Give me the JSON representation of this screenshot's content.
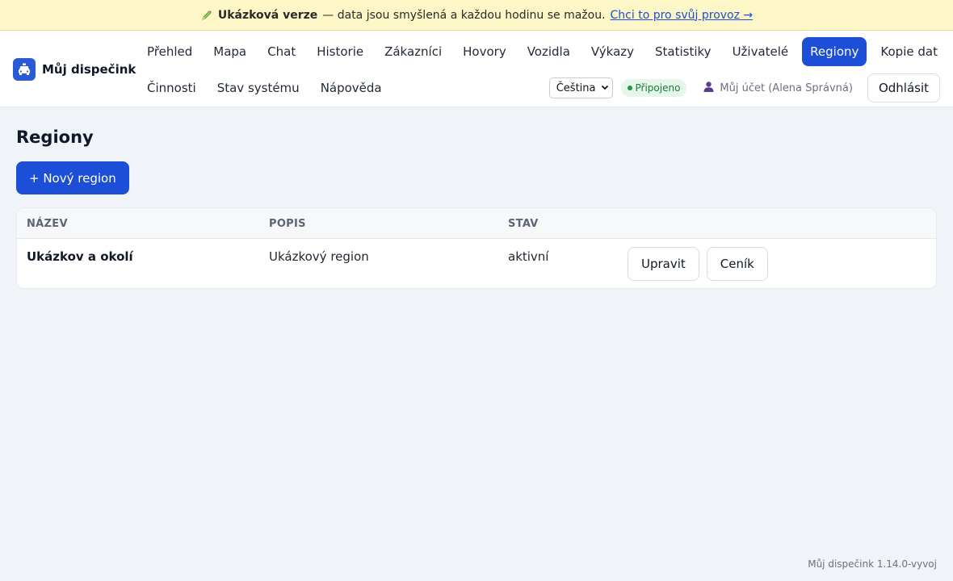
{
  "banner": {
    "icon": "pencil-icon",
    "strong": "Ukázková verze",
    "text": "— data jsou smyšlená a každou hodinu se mažou.",
    "link": "Chci to pro svůj provoz →"
  },
  "brand": {
    "icon": "taxi-icon",
    "name": "Můj dispečink",
    "color": "#2a5bd7"
  },
  "nav": {
    "row1": [
      "Přehled",
      "Mapa",
      "Chat",
      "Historie",
      "Zákazníci",
      "Hovory",
      "Vozidla",
      "Výkazy",
      "Statistiky",
      "Uživatelé",
      "Regiony",
      "Kopie dat"
    ],
    "row2": [
      "Činnosti",
      "Stav systému",
      "Nápověda"
    ],
    "active": "Regiony",
    "accent": "#1d4ed8"
  },
  "tools": {
    "language": "Čeština",
    "status": "Připojeno",
    "status_color": "#1c7a37",
    "account": "Můj účet (Alena Správná)",
    "account_icon": "user-icon",
    "logout": "Odhlásit"
  },
  "page": {
    "title": "Regiony",
    "new_button": "+ Nový region"
  },
  "table": {
    "columns": [
      "NÁZEV",
      "POPIS",
      "STAV"
    ],
    "rows": [
      {
        "name": "Ukázkov a okolí",
        "description": "Ukázkový region",
        "status": "aktivní",
        "actions": [
          "Upravit",
          "Ceník"
        ]
      }
    ]
  },
  "footer": {
    "version": "Můj dispečink 1.14.0-vyvoj"
  }
}
